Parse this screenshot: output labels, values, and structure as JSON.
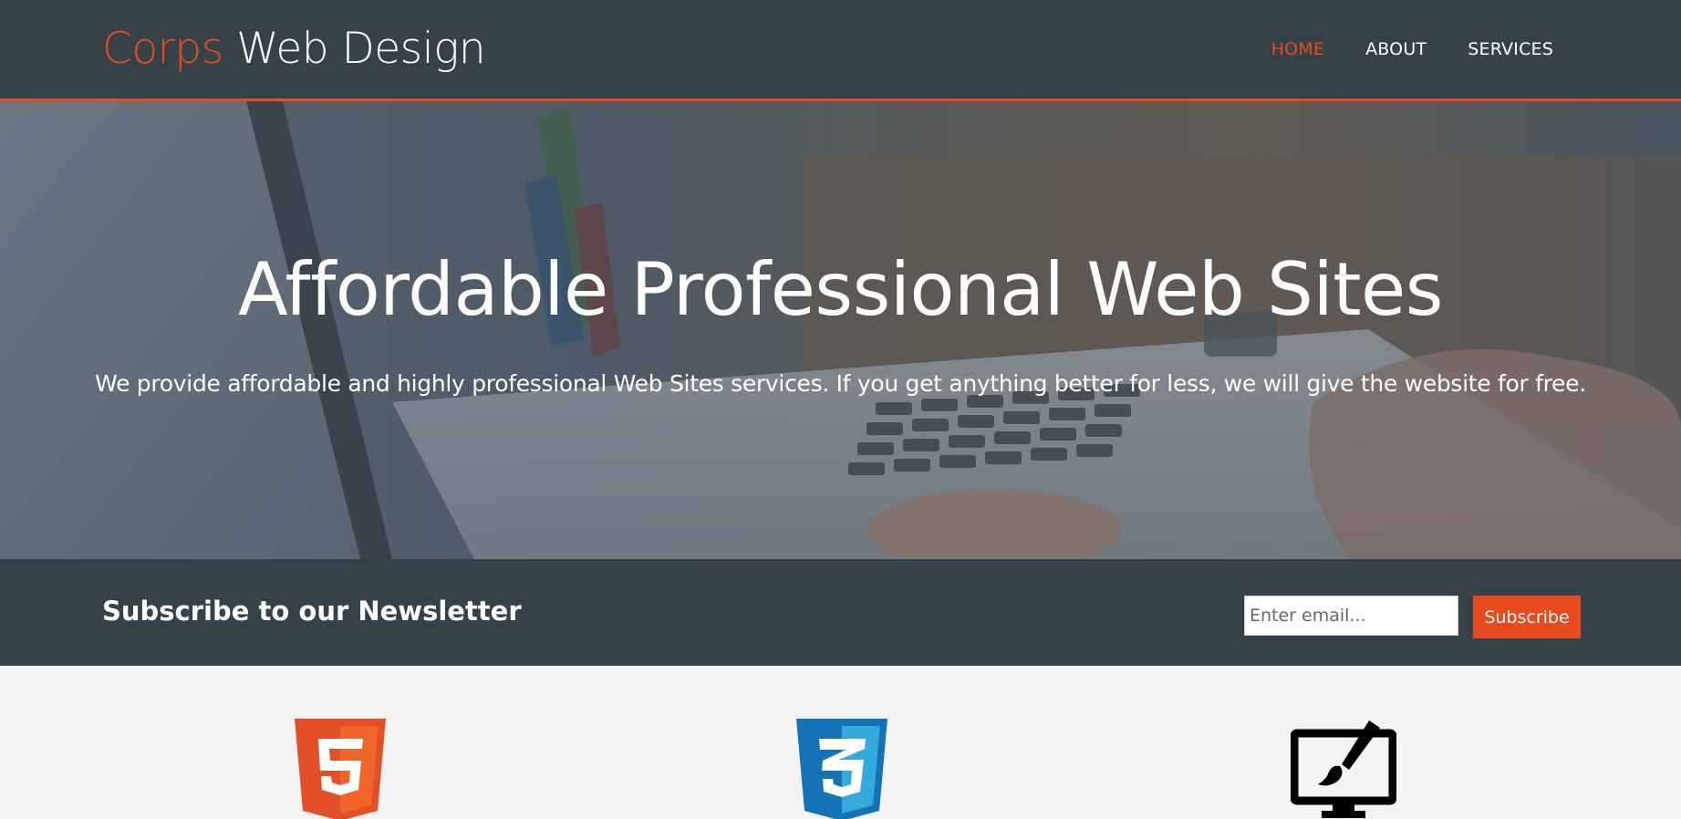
{
  "header": {
    "brand_accent": "Corps",
    "brand_rest": " Web Design",
    "nav": [
      {
        "label": "Home",
        "active": true
      },
      {
        "label": "About",
        "active": false
      },
      {
        "label": "Services",
        "active": false
      }
    ]
  },
  "showcase": {
    "title": "Affordable Professional Web Sites",
    "text": "We provide affordable and highly professional Web Sites services. If you get anything better for less, we will give the website for free."
  },
  "newsletter": {
    "title": "Subscribe to our Newsletter",
    "email_placeholder": "Enter email...",
    "subscribe_label": "Subscribe"
  },
  "boxes": [
    {
      "icon": "html5-logo-icon"
    },
    {
      "icon": "css3-logo-icon"
    },
    {
      "icon": "monitor-brush-icon"
    }
  ],
  "colors": {
    "accent": "#e8491d",
    "dark": "#35424a",
    "light": "#f3f3f3"
  }
}
